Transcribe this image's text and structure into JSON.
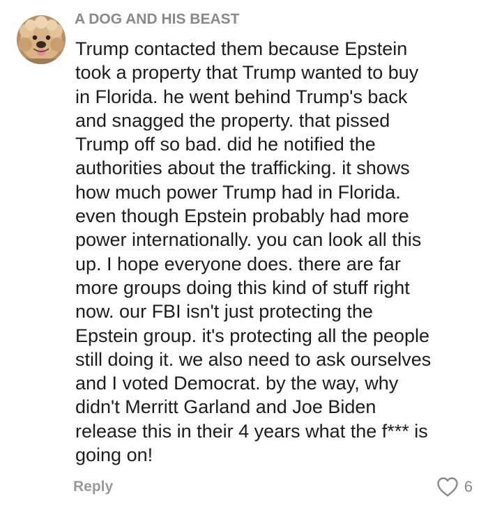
{
  "comment": {
    "username": "A DOG AND HIS BEAST",
    "avatar_icon": "dog-avatar-icon",
    "text": "Trump contacted them because Epstein\ntook a property that Trump wanted to buy\nin Florida. he went behind Trump's back\nand snagged the property. that pissed\nTrump off so bad. did he notified the\nauthorities about the trafficking. it shows\nhow much power Trump had in Florida.\neven though Epstein probably had more\npower internationally. you can look all this\nup. I hope everyone does. there are far\nmore groups doing this kind of stuff right\nnow. our FBI isn't just protecting the\nEpstein group. it's protecting all the people\nstill doing it. we also need to ask ourselves\nand I voted Democrat. by the way, why\ndidn't Merritt Garland and Joe Biden\nrelease this in their 4 years what the f*** is\ngoing on!",
    "reply_label": "Reply",
    "like_icon": "heart-outline-icon",
    "like_count": "6"
  },
  "colors": {
    "username": "#878a8c",
    "body_text": "#1c1c1c",
    "reply": "#9a9a9a",
    "heart": "#8a8a8a"
  }
}
